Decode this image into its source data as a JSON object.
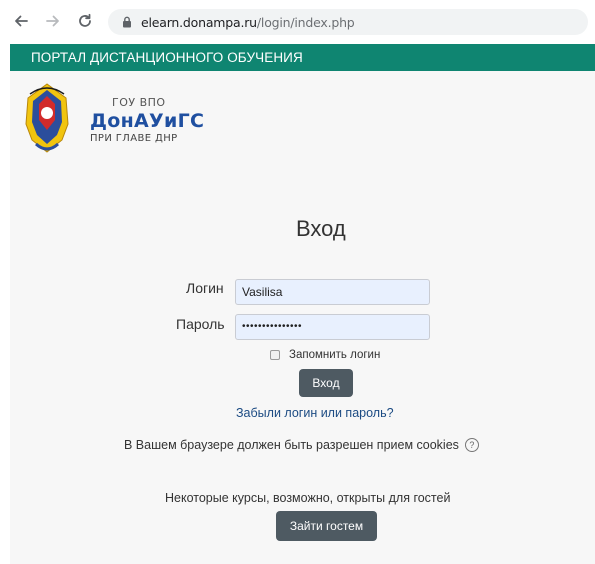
{
  "browser": {
    "url_host": "elearn.donampa.ru",
    "url_path": "/login/index.php"
  },
  "header": {
    "portal_title": "ПОРТАЛ ДИСТАНЦИОННОГО ОБУЧЕНИЯ"
  },
  "brand": {
    "line1": "ГОУ ВПО",
    "line2": "ДонАУиГС",
    "line3": "ПРИ ГЛАВЕ ДНР"
  },
  "login": {
    "title": "Вход",
    "username_label": "Логин",
    "username_value": "Vasilisa",
    "password_label": "Пароль",
    "password_value": "•••••••••••••••",
    "remember_label": "Запомнить логин",
    "submit_label": "Вход",
    "forgot_link": "Забыли логин или пароль?",
    "cookies_notice": "В Вашем браузере должен быть разрешен прием cookies",
    "help_icon_glyph": "?",
    "guest_notice": "Некоторые курсы, возможно, открыты для гостей",
    "guest_button": "Зайти гостем"
  },
  "colors": {
    "header_bar": "#0f8571",
    "button": "#4e5a62",
    "link": "#1c4b83",
    "input_bg": "#e8f0fe"
  }
}
